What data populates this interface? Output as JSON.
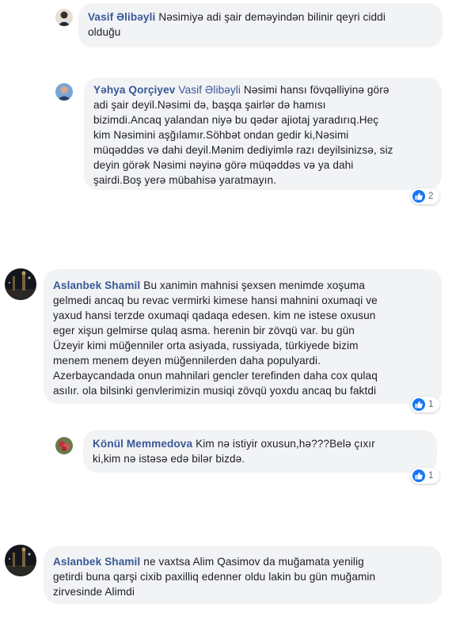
{
  "colors": {
    "name_link": "#385898",
    "bubble_bg": "#f2f3f5",
    "like_blue": "#1877f2"
  },
  "comments": [
    {
      "author": "Vasif Əlibəyli",
      "text": "Nəsimiyə adi şair deməyindən bilinir qeyri ciddi\nolduğu"
    },
    {
      "author": "Yəhya Qorçiyev",
      "mention": "Vasif Əlibəyli",
      "text": " Nəsimi hansı fövqəlliyinə görə\nadi şair deyil.Nəsimi də, başqa şairlər də hamısı\nbizimdi.Ancaq yalandan niyə bu qədər ajiotaj yaradırıq.Heç\nkim Nəsimini aşğılamır.Söhbət ondan gedir ki,Nəsimi\nmüqəddəs və dahi deyil.Mənim dediyimlə razı deyilsinizsə, siz\ndeyin görək Nəsimi nəyinə görə müqəddəs və ya dahi\nşairdi.Boş yerə mübahisə yaratmayın.",
      "reactions": "2"
    },
    {
      "author": "Aslanbek Shamil",
      "text": "Bu xanimin mahnisi şexsen menimde xoşuma\ngelmedi ancaq bu revac vermirki kimese hansi mahnini oxumaqi ve\nyaxud hansi terzde oxumaqi qadaqa edesen. kim ne istese oxusun\neger xişun gelmirse qulaq asma. herenin bir zövqü var. bu gün\nÜzeyir kimi müğenniler orta asiyada, russiyada, türkiyede bizim\nmenem menem deyen müğennilerden daha populyardi.\nAzerbaycandada onun mahnilari gencler terefinden daha cox qulaq\nasılır. ola bilsinki genvlerimizin musiqi zövqü yoxdu ancaq bu faktdi",
      "reactions": "1"
    },
    {
      "author": "Könül Memmedova",
      "text": "Kim nə istiyir oxusun,hə???Belə çıxır\nki,kim nə istəsə edə bilər bizdə.",
      "reactions": "1"
    },
    {
      "author": "Aslanbek Shamil",
      "text": "ne vaxtsa Alim Qasimov da muğamata yenilig\ngetirdi buna qarşi cixib paxilliq edenner oldu lakin bu gün muğamin\nzirvesinde Alimdi"
    }
  ]
}
